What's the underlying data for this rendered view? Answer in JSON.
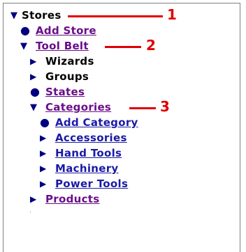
{
  "tree": {
    "stores": {
      "label": "Stores",
      "icon": "triangle-down-icon"
    },
    "add_store": {
      "label": "Add Store",
      "icon": "bullet-icon"
    },
    "tool_belt": {
      "label": "Tool Belt",
      "icon": "triangle-down-icon"
    },
    "wizards": {
      "label": "Wizards",
      "icon": "triangle-right-icon"
    },
    "groups": {
      "label": "Groups",
      "icon": "triangle-right-icon"
    },
    "states": {
      "label": "States",
      "icon": "bullet-icon"
    },
    "categories": {
      "label": "Categories",
      "icon": "triangle-down-icon"
    },
    "add_category": {
      "label": "Add Category",
      "icon": "bullet-icon"
    },
    "accessories": {
      "label": "Accessories",
      "icon": "triangle-right-icon"
    },
    "hand_tools": {
      "label": "Hand Tools",
      "icon": "triangle-right-icon"
    },
    "machinery": {
      "label": "Machinery",
      "icon": "triangle-right-icon"
    },
    "power_tools": {
      "label": "Power Tools",
      "icon": "triangle-right-icon"
    },
    "products": {
      "label": "Products",
      "icon": "triangle-right-icon"
    }
  },
  "callouts": {
    "one": "1",
    "two": "2",
    "three": "3"
  },
  "colors": {
    "marker": "#000080",
    "visited_link": "#6a0d8a",
    "link": "#1a1aa6",
    "callout": "#e00000",
    "border": "#7f7f7f"
  }
}
